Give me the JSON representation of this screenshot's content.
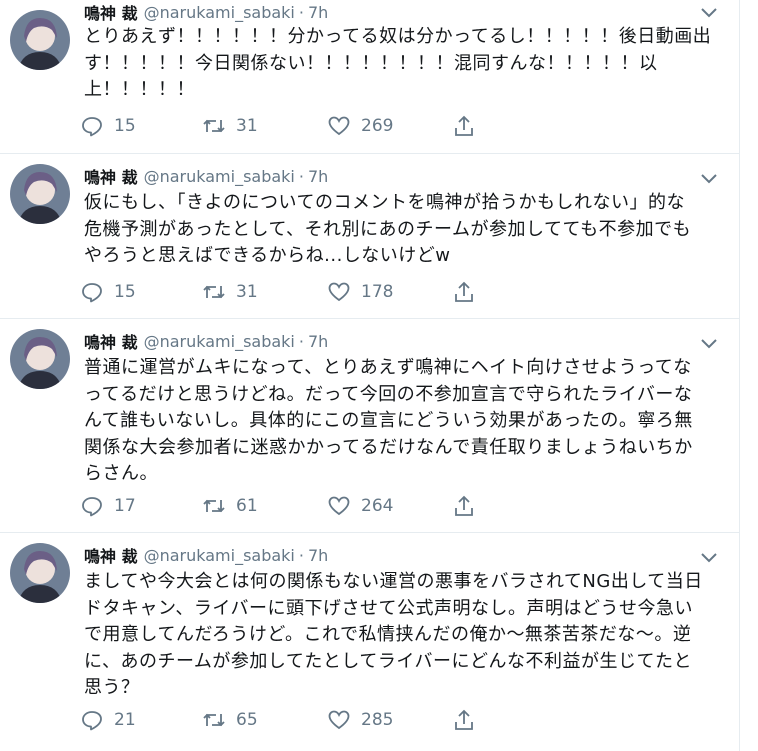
{
  "tweets": [
    {
      "name": "鳴神 裁",
      "handle": "@narukami_sabaki",
      "time": "7h",
      "lines": [
        "とりあえず！！！！！！分かってる奴は分かってるし！！！！！後日動画出",
        "す！！！！！今日関係ない！！！！！！！！混同すんな！！！！！以",
        "上！！！！！"
      ],
      "replies": "15",
      "retweets": "31",
      "likes": "269"
    },
    {
      "name": "鳴神 裁",
      "handle": "@narukami_sabaki",
      "time": "7h",
      "lines": [
        "仮にもし、「きよのについてのコメントを鳴神が拾うかもしれない」的な",
        "危機予測があったとして、それ別にあのチームが参加してても不参加でも",
        "やろうと思えばできるからね...しないけどw"
      ],
      "replies": "15",
      "retweets": "31",
      "likes": "178"
    },
    {
      "name": "鳴神 裁",
      "handle": "@narukami_sabaki",
      "time": "7h",
      "lines": [
        "普通に運営がムキになって、とりあえず鳴神にヘイト向けさせようってな",
        "ってるだけと思うけどね。だって今回の不参加宣言で守られたライバーな",
        "んて誰もいないし。具体的にこの宣言にどういう効果があったの。寧ろ無",
        "関係な大会参加者に迷惑かかってるだけなんで責任取りましょうねいちか",
        "らさん。"
      ],
      "replies": "17",
      "retweets": "61",
      "likes": "264"
    },
    {
      "name": "鳴神 裁",
      "handle": "@narukami_sabaki",
      "time": "7h",
      "lines": [
        "ましてや今大会とは何の関係もない運営の悪事をバラされてNG出して当日",
        "ドタキャン、ライバーに頭下げさせて公式声明なし。声明はどうせ今急い",
        "で用意してんだろうけど。これで私情挟んだの俺か～無茶苦茶だな～。逆",
        "に、あのチームが参加してたとしてライバーにどんな不利益が生じてたと",
        "思う？"
      ],
      "replies": "21",
      "retweets": "65",
      "likes": "285"
    }
  ],
  "colors": {
    "text": "#14171a",
    "secondary": "#657786",
    "divider": "#e6ecf0"
  }
}
